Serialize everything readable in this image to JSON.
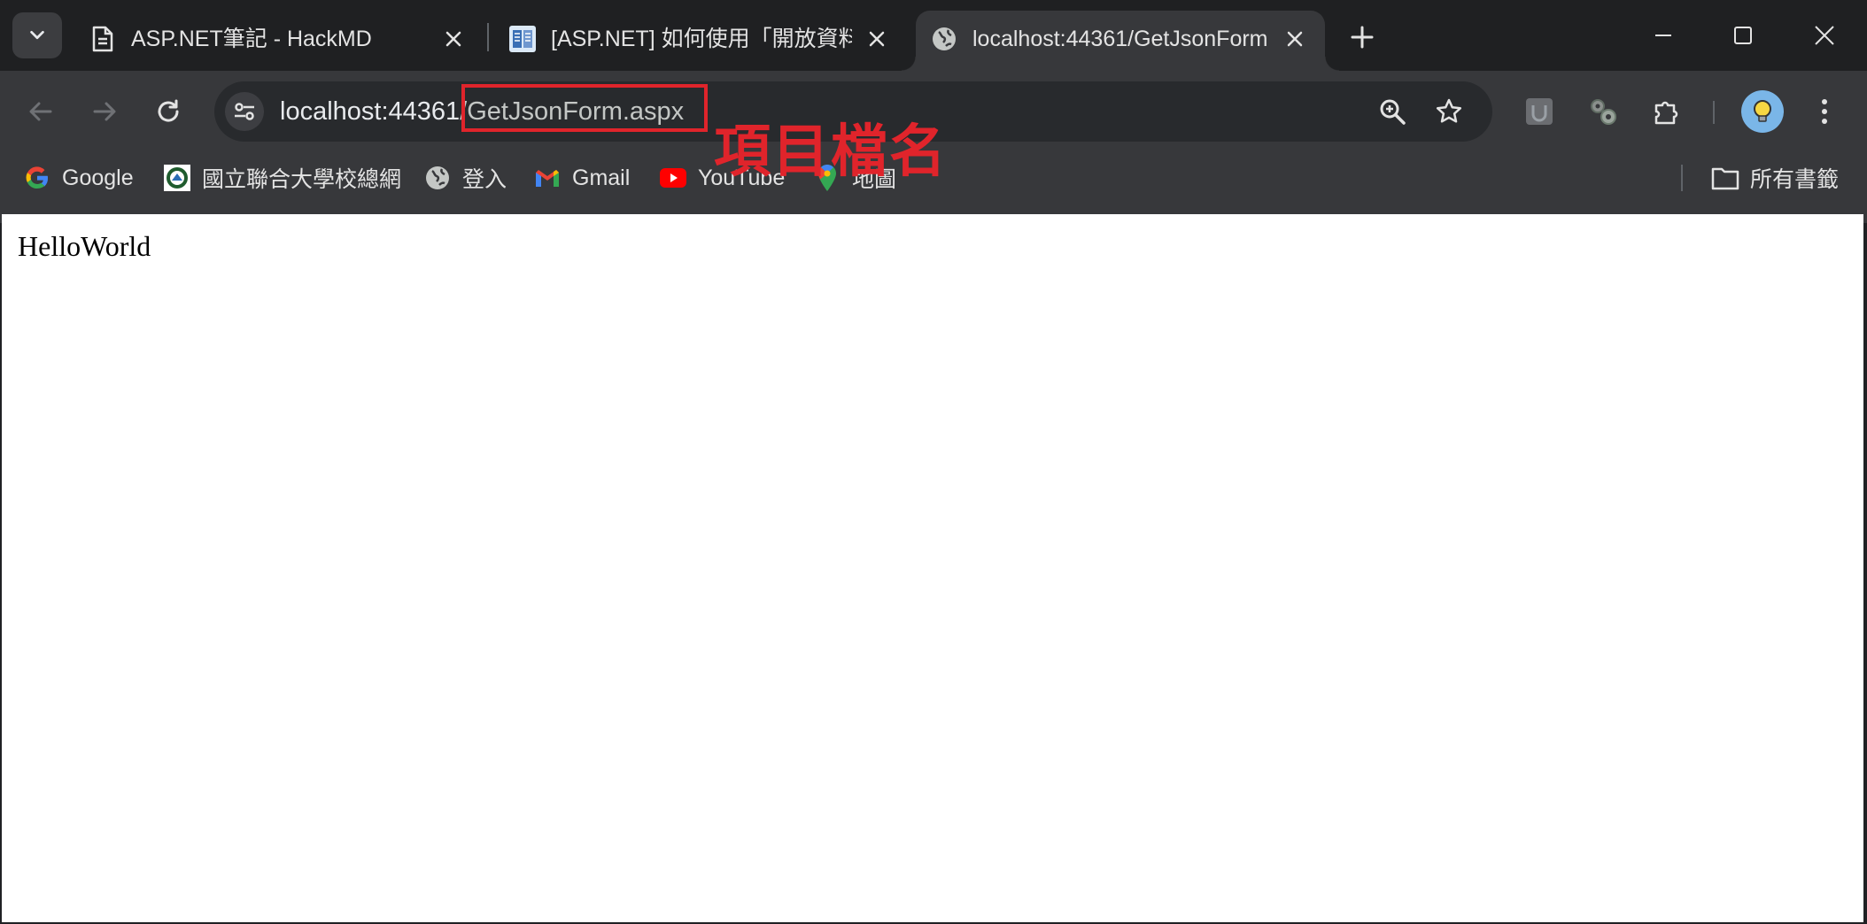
{
  "tabs": [
    {
      "title": "ASP.NET筆記 - HackMD",
      "favicon": "document-icon",
      "active": false
    },
    {
      "title": "[ASP.NET] 如何使用「開放資料",
      "favicon": "blog-favicon",
      "active": false
    },
    {
      "title": "localhost:44361/GetJsonForm",
      "favicon": "globe-icon",
      "active": true
    }
  ],
  "omnibox": {
    "host": "localhost:44361",
    "path": "/GetJsonForm.aspx"
  },
  "annotation": {
    "text": "項目檔名",
    "color": "#e0242b"
  },
  "bookmarks": [
    {
      "label": "Google",
      "icon": "google-icon"
    },
    {
      "label": "國立聯合大學校總網",
      "icon": "university-icon"
    },
    {
      "label": "登入",
      "icon": "globe-icon"
    },
    {
      "label": "Gmail",
      "icon": "gmail-icon"
    },
    {
      "label": "YouTube",
      "icon": "youtube-icon"
    },
    {
      "label": "地圖",
      "icon": "maps-icon"
    }
  ],
  "all_bookmarks": "所有書籤",
  "page": {
    "content": "HelloWorld"
  }
}
